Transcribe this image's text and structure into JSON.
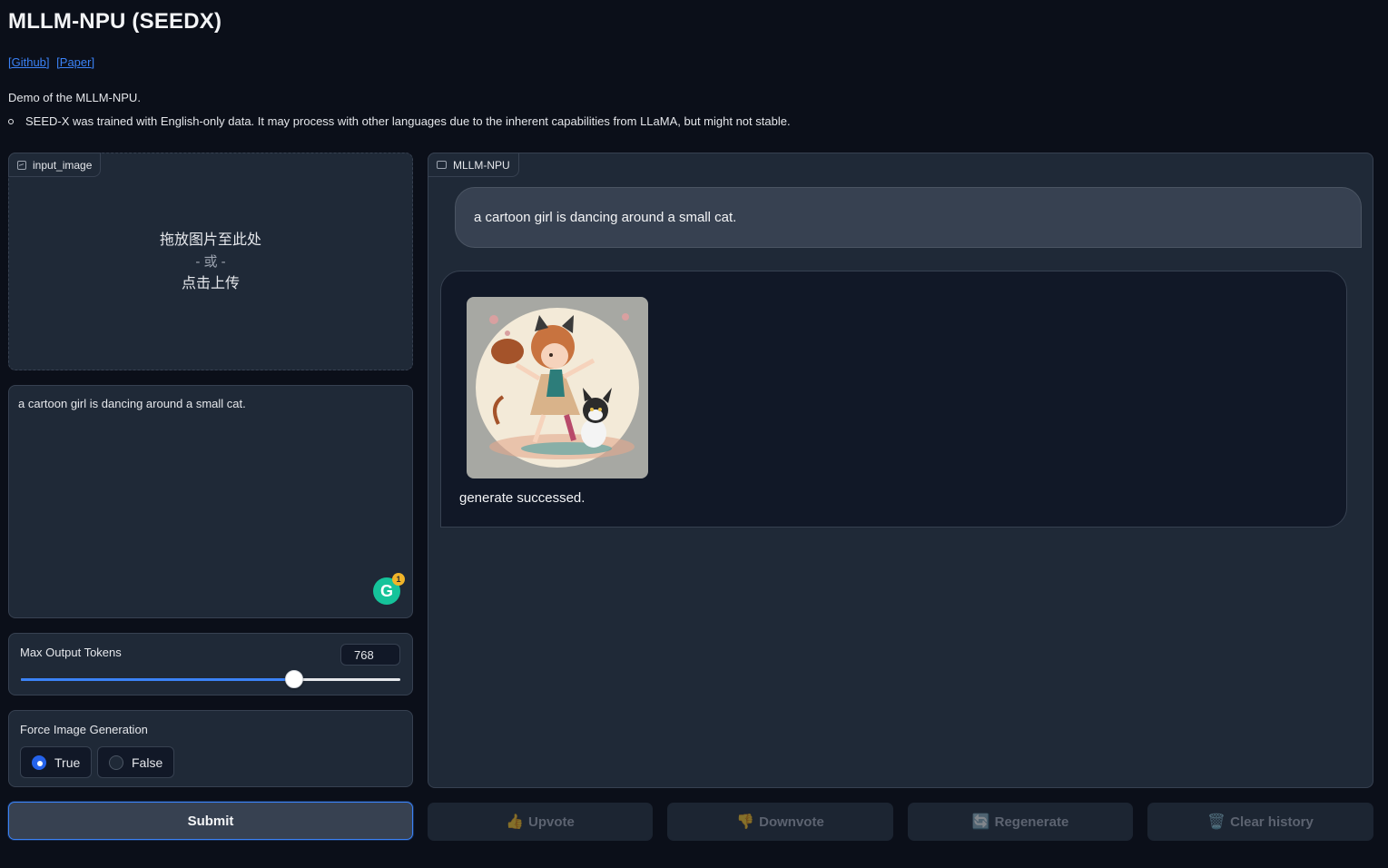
{
  "header": {
    "title": "MLLM-NPU (SEEDX)",
    "links": [
      "[Github]",
      "[Paper]"
    ],
    "description": "Demo of the MLLM-NPU.",
    "note": "SEED-X was trained with English-only data. It may process with other languages due to the inherent capabilities from LLaMA, but might not stable."
  },
  "upload": {
    "label": "input_image",
    "drop_text": "拖放图片至此处",
    "or_text": "- 或 -",
    "click_text": "点击上传"
  },
  "prompt": {
    "value": "a cartoon girl is dancing around a small cat.",
    "grammarly_badge": "1"
  },
  "max_tokens": {
    "label": "Max Output Tokens",
    "value": "768",
    "fraction": 0.72
  },
  "force_image": {
    "label": "Force Image Generation",
    "options": [
      "True",
      "False"
    ],
    "selected": "True"
  },
  "submit_label": "Submit",
  "chat": {
    "label": "MLLM-NPU",
    "user_message": "a cartoon girl is dancing around a small cat.",
    "bot_text": "generate successed."
  },
  "actions": {
    "upvote": "Upvote",
    "downvote": "Downvote",
    "regenerate": "Regenerate",
    "clear": "Clear history"
  }
}
